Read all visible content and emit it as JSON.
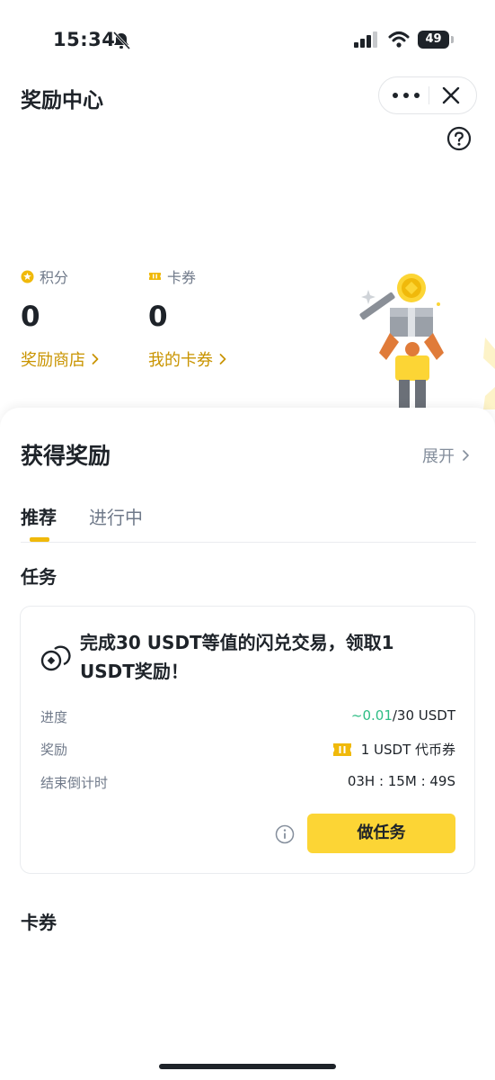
{
  "status_bar": {
    "time": "15:34",
    "battery": "49",
    "icons": [
      "bell-off-icon",
      "signal-icon",
      "wifi-icon",
      "battery-icon"
    ]
  },
  "header": {
    "title": "奖励中心",
    "more_icon": "more-dots-icon",
    "close_icon": "close-icon",
    "help_icon": "help-icon"
  },
  "balances": {
    "points": {
      "label": "积分",
      "value": "0",
      "link": "奖励商店",
      "icon": "points-icon"
    },
    "coupons": {
      "label": "卡券",
      "value": "0",
      "link": "我的卡券",
      "icon": "ticket-icon"
    }
  },
  "rewards": {
    "title": "获得奖励",
    "expand": "展开",
    "tabs": [
      {
        "label": "推荐",
        "active": true
      },
      {
        "label": "进行中",
        "active": false
      }
    ]
  },
  "tasks_section": {
    "title": "任务",
    "task": {
      "title": "完成30 USDT等值的闪兑交易，领取1 USDT奖励！",
      "progress_label": "进度",
      "progress_current": "~0.01",
      "progress_total": "/30 USDT",
      "reward_label": "奖励",
      "reward_value": "1 USDT 代币券",
      "countdown_label": "结束倒计时",
      "countdown_value": "03H : 15M : 49S",
      "button": "做任务"
    }
  },
  "coupons_section": {
    "title": "卡券"
  },
  "colors": {
    "brand_yellow": "#fcd535",
    "gold_text": "#c99400",
    "green": "#2ebd85",
    "text_primary": "#1e2329",
    "text_secondary": "#707a8a"
  }
}
